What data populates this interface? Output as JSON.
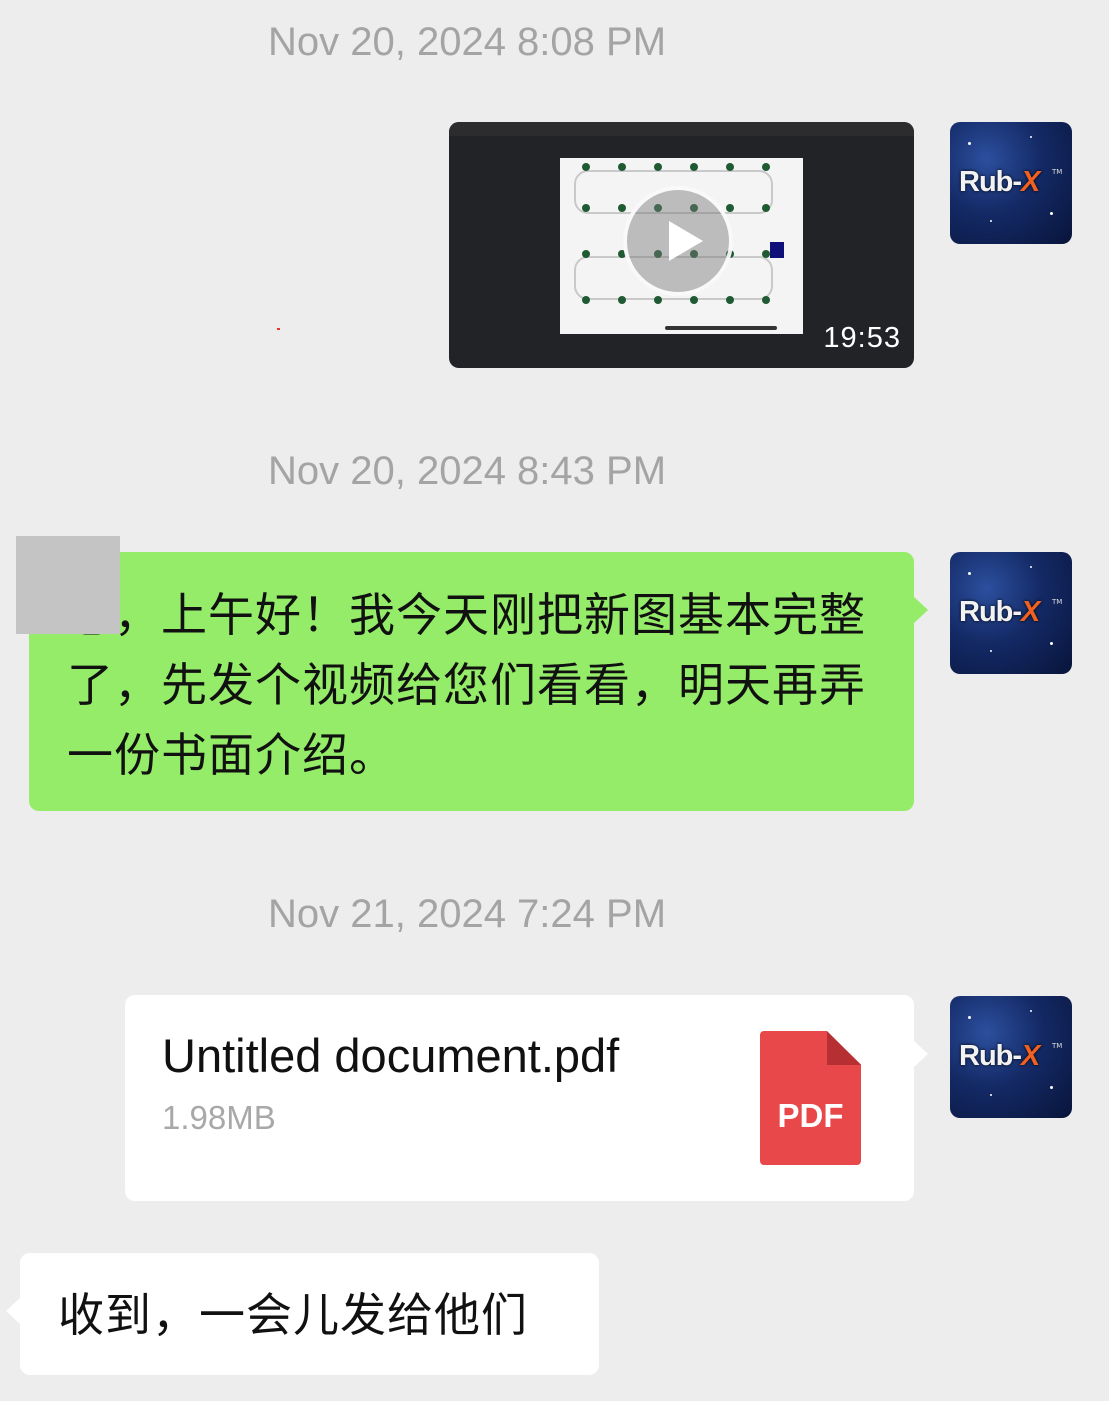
{
  "messages": [
    {
      "type": "timestamp",
      "text": "Nov 20, 2024 8:08 PM"
    },
    {
      "type": "video",
      "sender": "me",
      "duration": "19:53",
      "avatar_logo": "Rub-X"
    },
    {
      "type": "timestamp",
      "text": "Nov 20, 2024 8:43 PM"
    },
    {
      "type": "text",
      "sender": "me",
      "text": "总，上午好！我今天刚把新图基本完整了，先发个视频给您们看看，明天再弄一份书面介绍。"
    },
    {
      "type": "timestamp",
      "text": "Nov 21, 2024 7:24 PM"
    },
    {
      "type": "file",
      "sender": "me",
      "file_name": "Untitled document.pdf",
      "file_size": "1.98MB",
      "file_icon_label": "PDF"
    },
    {
      "type": "text",
      "sender": "other",
      "text": "收到，一会儿发给他们"
    }
  ],
  "avatar": {
    "logo_main": "Rub-",
    "logo_accent": "X",
    "trademark": "TM"
  },
  "colors": {
    "background": "#ededed",
    "my_bubble": "#95ec69",
    "other_bubble": "#ffffff",
    "pdf_red": "#e8484a"
  }
}
